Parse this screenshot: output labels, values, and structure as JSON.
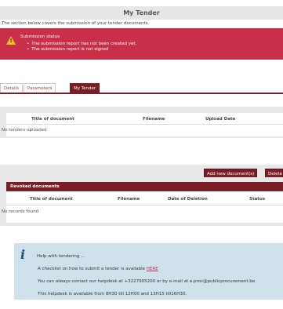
{
  "header": {
    "title": "My Tender",
    "intro": "The section below covers the submission of your tender documents."
  },
  "alert": {
    "icon": "warning-icon",
    "title": "Submission status",
    "items": [
      "The submission report has not been created yet.",
      "The submission report is not signed"
    ]
  },
  "tabs": [
    {
      "label": "Details"
    },
    {
      "label": "Parameters"
    },
    {
      "label": "My Tender"
    }
  ],
  "documents": {
    "columns": [
      "Title of document",
      "Filename",
      "Upload Date"
    ],
    "empty": "No tenders uploaded"
  },
  "actions": {
    "add": "Add new document(s)",
    "delete": "Delete"
  },
  "revoked": {
    "header": "Revoked documents",
    "columns": [
      "Title of document",
      "Filename",
      "Date of Deletion",
      "Status"
    ],
    "empty": "No records found"
  },
  "help": {
    "icon": "info-icon",
    "title": "Help with tendering ...",
    "line1_prefix": "A checklist on how to submit a tender is available ",
    "line1_link": "HERE",
    "line2": "You can always contact our helpdesk at +3227905200 or by e-mail at e.proc@publicprocurement.be.",
    "line3": "This helpdesk is available from 8H30 till 12H00 and 13H15 till16H30."
  },
  "colors": {
    "alert_bg": "#c8304a",
    "accent": "#7a1e26",
    "help_bg": "#cfe2ec"
  }
}
